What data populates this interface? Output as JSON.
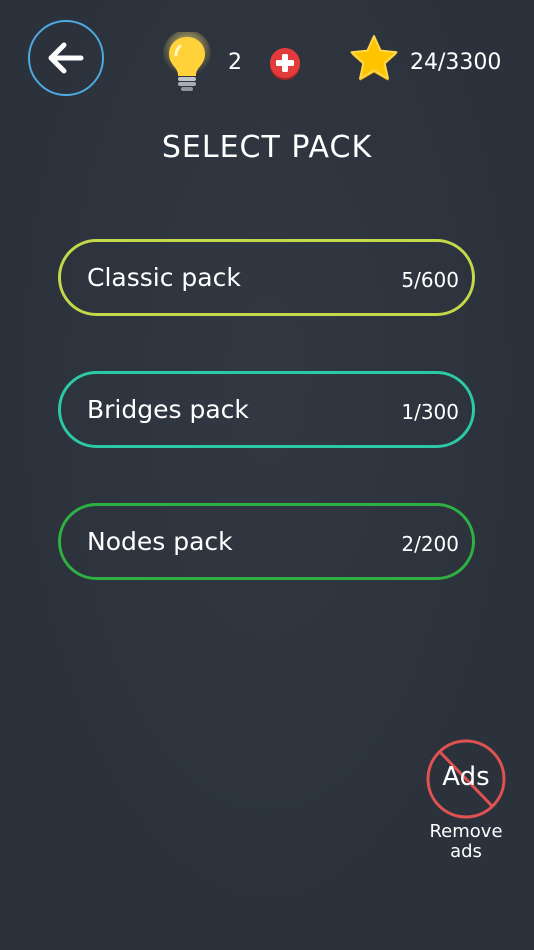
{
  "header": {
    "hint_count": "2",
    "stars": "24/3300"
  },
  "title": "SELECT PACK",
  "packs": [
    {
      "name": "Classic pack",
      "progress": "5/600",
      "border_color": "#c4d94a"
    },
    {
      "name": "Bridges pack",
      "progress": "1/300",
      "border_color": "#2cc9a6"
    },
    {
      "name": "Nodes pack",
      "progress": "2/200",
      "border_color": "#2fb043"
    }
  ],
  "remove_ads": {
    "badge_text": "Ads",
    "label_line1": "Remove",
    "label_line2": "ads"
  },
  "icons": {
    "back": "arrow-left-icon",
    "hint": "lightbulb-icon",
    "add": "plus-circle-icon",
    "star": "star-icon",
    "no_ads": "no-ads-icon"
  },
  "colors": {
    "background": "#2b323c",
    "back_ring": "#4fa8e0",
    "add_button": "#e23b3b",
    "star": "#ffc400",
    "no_ads_ring": "#e05252"
  }
}
